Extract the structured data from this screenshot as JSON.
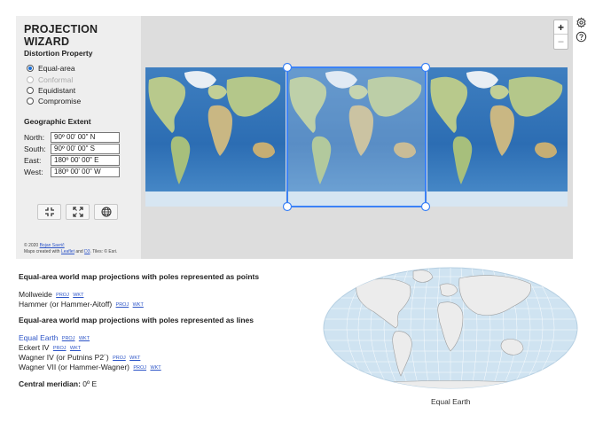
{
  "panel": {
    "title": "PROJECTION WIZARD",
    "distortion_label": "Distortion Property",
    "options": [
      {
        "label": "Equal-area",
        "checked": true,
        "disabled": false
      },
      {
        "label": "Conformal",
        "checked": false,
        "disabled": true
      },
      {
        "label": "Equidistant",
        "checked": false,
        "disabled": false
      },
      {
        "label": "Compromise",
        "checked": false,
        "disabled": false
      }
    ],
    "extent_label": "Geographic Extent",
    "extent": {
      "north_label": "North:",
      "north": "90º 00' 00\" N",
      "south_label": "South:",
      "south": "90º 00' 00\" S",
      "east_label": "East:",
      "east": "180º 00' 00\" E",
      "west_label": "West:",
      "west": "180º 00' 00\" W"
    },
    "buttons": [
      "shrink-extent-icon",
      "expand-extent-icon",
      "globe-icon"
    ],
    "credit_line1_prefix": "© 2020 ",
    "credit_author": "Bojan Savrič",
    "credit_line2_prefix": "Maps created with ",
    "credit_leaflet": "Leaflet",
    "credit_and": " and ",
    "credit_d3": "D3",
    "credit_tiles": ". Tiles: © Esri."
  },
  "map_controls": {
    "zoom_in": "+",
    "zoom_out": "−"
  },
  "results": {
    "heading_points": "Equal-area world map projections with poles represented as points",
    "points_items": [
      {
        "name": "Mollweide",
        "proj": "PROJ",
        "wkt": "WKT"
      },
      {
        "name": "Hammer (or Hammer-Aitoff)",
        "proj": "PROJ",
        "wkt": "WKT"
      }
    ],
    "heading_lines": "Equal-area world map projections with poles represented as lines",
    "lines_items": [
      {
        "name": "Equal Earth",
        "proj": "PROJ",
        "wkt": "WKT"
      },
      {
        "name": "Eckert IV",
        "proj": "PROJ",
        "wkt": "WKT"
      },
      {
        "name": "Wagner IV (or Putnins P2´)",
        "proj": "PROJ",
        "wkt": "WKT"
      },
      {
        "name": "Wagner VII (or Hammer-Wagner)",
        "proj": "PROJ",
        "wkt": "WKT"
      }
    ],
    "central_meridian_label": "Central meridian:",
    "central_meridian_value": "0º E"
  },
  "preview": {
    "caption": "Equal Earth"
  },
  "colors": {
    "ocean": "#2f72b8",
    "selection": "#3b82f6",
    "land": "#b9c98f",
    "panel": "#eeeeee"
  }
}
